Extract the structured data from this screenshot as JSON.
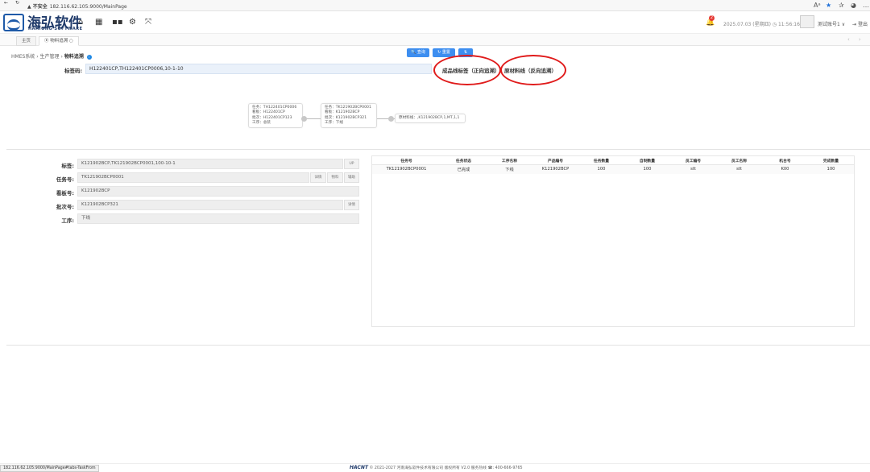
{
  "browser": {
    "security_label": "不安全",
    "url": "182.116.62.105:9000/MainPage"
  },
  "header": {
    "logo_cn": "海弘软件",
    "logo_en": "HAIHONG SOFTWARE",
    "notification_count": "2",
    "datetime": "2025.07.03 (星期四)  ◷ 11:56:16",
    "user": "测试账号1 ∨",
    "logout": "登出"
  },
  "tabs": [
    {
      "label": "主页"
    },
    {
      "label": "⦿ 物料追溯 ○"
    }
  ],
  "breadcrumb": {
    "root": "HMES系统",
    "parent": "生产管理",
    "current": "物料追溯",
    "sep": "›"
  },
  "toolbar": {
    "query_label": "🔍 查询",
    "reset_label": "↻ 重置",
    "swap_label": "⇅"
  },
  "label_code": {
    "label": "标签码:",
    "value": "H122401CP,TH122401CP0006,10-1-10"
  },
  "modes": {
    "forward": "成品线标签（正向追溯）",
    "reverse": "原材料线（反向追溯）"
  },
  "trace": {
    "nodes": [
      {
        "lines": [
          "任务：TH122401CP0006",
          "看板：H122401CP",
          "批次：H122401CP123",
          "工序：总装"
        ]
      },
      {
        "lines": [
          "任务：TK121902BCP0001",
          "看板：K121902BCP",
          "批次：K121902BCP321",
          "工序：下线"
        ]
      },
      {
        "lines": [
          "原材料线：,K121902BCP,1,MT,1,1"
        ]
      }
    ]
  },
  "form": {
    "label_tag": {
      "label": "标签:",
      "value": "K121902BCP,TK121902BCP0001,100-10-1",
      "btn": "UP"
    },
    "task": {
      "label": "任务号:",
      "value": "TK121902BCP0001",
      "btns": [
        "详情",
        "物料",
        "辅助"
      ]
    },
    "kanban": {
      "label": "看板号:",
      "value": "K121902BCP"
    },
    "batch": {
      "label": "批次号:",
      "value": "K121902BCP321",
      "btn": "详情"
    },
    "process": {
      "label": "工序:",
      "value": "下线"
    }
  },
  "table": {
    "headers": [
      "任务号",
      "任务状态",
      "工序名称",
      "产品编号",
      "任务数量",
      "自制数量",
      "员工编号",
      "员工名称",
      "机台号",
      "完成数量"
    ],
    "rows": [
      [
        "TK121902BCP0001",
        "已完成",
        "下线",
        "K121902BCP",
        "100",
        "100",
        "stt",
        "stt",
        "K00",
        "100"
      ]
    ]
  },
  "footer": {
    "status_url": "182.116.62.105:9000/MainPage#tabs-TaskFrom",
    "brand": "HACNT",
    "copyright": "© 2021-2027 河南海弘软件技术有限公司 版权所有 V2.0 服务热线 ☎: 400-666-9765"
  },
  "colors": {
    "accent": "#3d8ef0",
    "annotation": "#e01b1b",
    "brand": "#1f3a6a"
  }
}
